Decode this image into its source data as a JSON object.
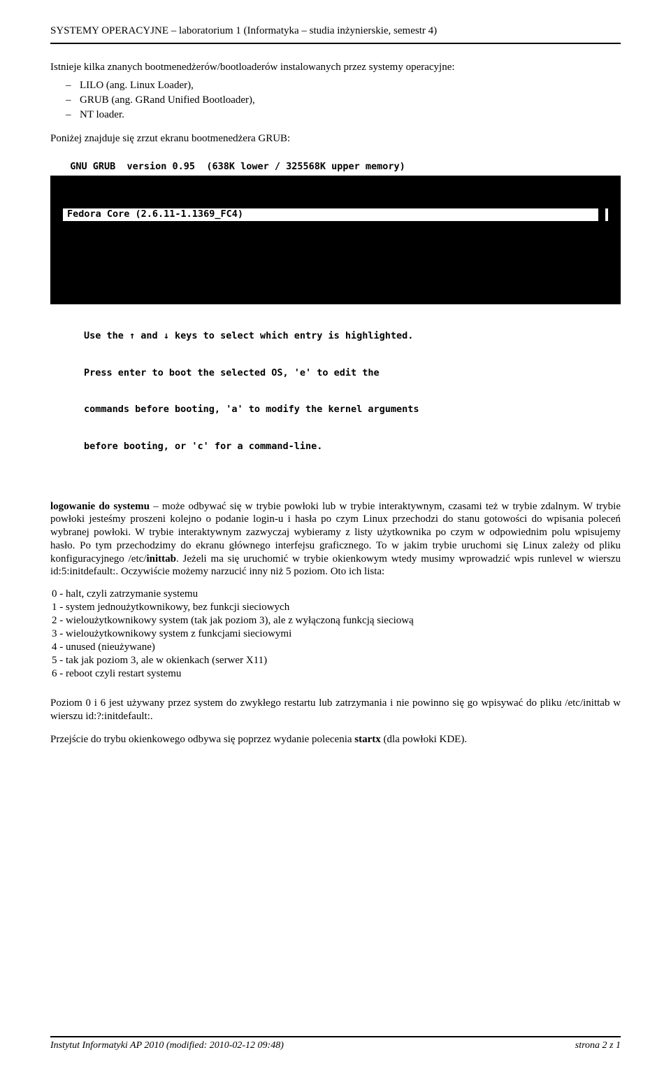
{
  "header": {
    "title": "SYSTEMY OPERACYJNE – laboratorium 1 (Informatyka – studia inżynierskie, semestr 4)"
  },
  "intro": {
    "text": "Istnieje kilka znanych bootmenedżerów/bootloaderów instalowanych przez systemy operacyjne:",
    "items": {
      "i0": "LILO (ang. Linux Loader),",
      "i1": "GRUB (ang. GRand Unified Bootloader),",
      "i2": "NT loader."
    },
    "caption": "Poniżej znajduje się zrzut ekranu bootmenedżera GRUB:"
  },
  "grub": {
    "header": "  GNU GRUB  version 0.95  (638K lower / 325568K upper memory)",
    "entry": "Fedora Core (2.6.11-1.1369_FC4)",
    "hint1": "Use the ↑ and ↓ keys to select which entry is highlighted.",
    "hint2": "Press enter to boot the selected OS, 'e' to edit the",
    "hint3": "commands before booting, 'a' to modify the kernel arguments",
    "hint4": "before booting, or 'c' for a command-line."
  },
  "main": {
    "lead_bold": "logowanie do systemu",
    "para1_rest": " – może odbywać się w trybie powłoki lub w trybie interaktywnym, czasami też w trybie zdalnym. W trybie powłoki jesteśmy proszeni kolejno o podanie login-u i hasła po czym Linux przechodzi do stanu gotowości do wpisania poleceń wybranej powłoki. W trybie interaktywnym zazwyczaj wybieramy z listy użytkownika po czym w odpowiednim polu wpisujemy hasło. Po tym przechodzimy do ekranu głównego interfejsu graficznego. To w jakim trybie uruchomi się Linux zależy od pliku konfiguracyjnego /etc/",
    "inittab": "inittab",
    "para1_tail": ". Jeżeli ma się uruchomić w trybie okienkowym wtedy musimy wprowadzić wpis runlevel w wierszu id:5:initdefault:. Oczywiście możemy narzucić inny niż 5 poziom. Oto ich lista:",
    "levels": {
      "l0": "0 - halt, czyli zatrzymanie systemu",
      "l1": "1 - system jednoużytkownikowy, bez funkcji sieciowych",
      "l2": "2 - wieloużytkownikowy system (tak jak poziom 3), ale z wyłączoną funkcją sieciową",
      "l3": "3 - wieloużytkownikowy system z funkcjami sieciowymi",
      "l4": "4 - unused (nieużywane)",
      "l5": "5 - tak jak poziom 3, ale w okienkach (serwer X11)",
      "l6": "6 - reboot czyli restart systemu"
    },
    "para2": "Poziom 0 i 6 jest używany przez system do zwykłego restartu lub zatrzymania i nie powinno się go wpisywać do pliku /etc/inittab w wierszu id:?:initdefault:.",
    "para3_pre": "Przejście do trybu okienkowego odbywa się poprzez wydanie polecenia ",
    "startx": "startx",
    "para3_post": " (dla powłoki KDE)."
  },
  "footer": {
    "left": "Instytut Informatyki AP 2010 (modified: 2010-02-12 09:48)",
    "right": "strona 2 z 1"
  }
}
